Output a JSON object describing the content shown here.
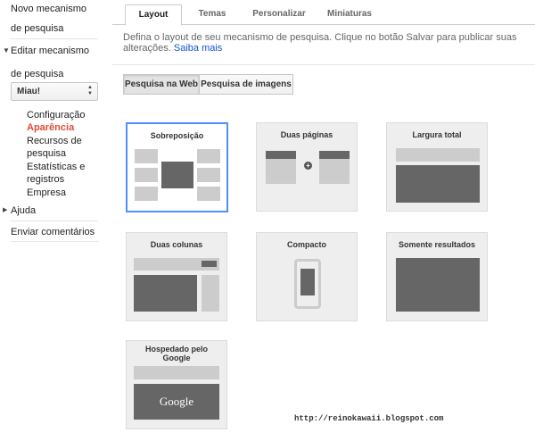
{
  "sidebar": {
    "new_engine": "Novo mecanismo de pesquisa",
    "edit_engine": "Editar mecanismo de pesquisa",
    "engine_select_value": "Miau!",
    "sub_items": [
      "Configuração",
      "Aparência",
      "Recursos de pesquisa",
      "Estatísticas e registros",
      "Empresa"
    ],
    "active_sub": "Aparência",
    "help": "Ajuda",
    "feedback": "Enviar comentários"
  },
  "tabs": [
    "Layout",
    "Temas",
    "Personalizar",
    "Miniaturas"
  ],
  "active_tab": "Layout",
  "description": "Defina o layout de seu mecanismo de pesquisa. Clique no botão Salvar para publicar suas alterações.",
  "learn_more": "Saiba mais",
  "toggle": {
    "web": "Pesquisa na Web",
    "images": "Pesquisa de imagens",
    "active": "Pesquisa na Web"
  },
  "layouts": [
    {
      "name": "Sobreposição",
      "selected": true
    },
    {
      "name": "Duas páginas",
      "selected": false
    },
    {
      "name": "Largura total",
      "selected": false
    },
    {
      "name": "Duas colunas",
      "selected": false
    },
    {
      "name": "Compacto",
      "selected": false
    },
    {
      "name": "Somente resultados",
      "selected": false
    },
    {
      "name": "Hospedado pelo Google",
      "selected": false
    }
  ],
  "google_logo_text": "Google",
  "watermark": "http://reinokawaii.blogspot.com",
  "colors": {
    "accent_red": "#dd4b39",
    "link_blue": "#15c",
    "selection_blue": "#4d90fe"
  }
}
